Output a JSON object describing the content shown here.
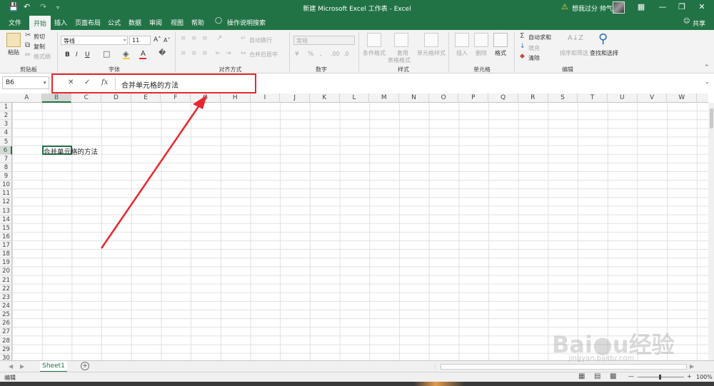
{
  "titlebar": {
    "title": "新建 Microsoft Excel 工作表 - Excel",
    "user": "想我过分 帅气",
    "save_icon": "save-icon",
    "undo_icon": "undo-icon",
    "redo_icon": "redo-icon",
    "warning_icon": "warning-icon"
  },
  "tabs": {
    "items": [
      "文件",
      "开始",
      "插入",
      "页面布局",
      "公式",
      "数据",
      "审阅",
      "视图",
      "帮助"
    ],
    "active": "开始",
    "tellme": "操作说明搜索",
    "share": "共享"
  },
  "ribbon": {
    "clipboard": {
      "label": "剪贴板",
      "paste": "粘贴",
      "cut": "剪切",
      "copy": "复制",
      "format_painter": "格式刷"
    },
    "font": {
      "label": "字体",
      "font_name": "等线",
      "font_size": "11",
      "bold": "B",
      "italic": "I",
      "underline": "U"
    },
    "alignment": {
      "label": "对齐方式",
      "wrap": "自动换行",
      "merge": "合并后居中"
    },
    "number": {
      "label": "数字",
      "format": "常规"
    },
    "styles": {
      "label": "样式",
      "conditional": "条件格式",
      "table_1": "套用",
      "table_2": "表格格式",
      "cell_styles": "单元格样式"
    },
    "cells": {
      "label": "单元格",
      "insert": "插入",
      "delete": "删除",
      "format": "格式"
    },
    "editing": {
      "label": "编辑",
      "autosum": "自动求和",
      "fill": "填充",
      "clear": "清除",
      "sort": "排序和筛选",
      "find": "查找和选择"
    }
  },
  "formula_bar": {
    "name_box": "B6",
    "cancel": "✕",
    "enter": "✓",
    "fx": "fx",
    "value": "合并单元格的方法"
  },
  "grid": {
    "columns": [
      "A",
      "B",
      "C",
      "D",
      "E",
      "F",
      "G",
      "H",
      "I",
      "J",
      "K",
      "L",
      "M",
      "N",
      "O",
      "P",
      "Q",
      "R",
      "S",
      "T",
      "U",
      "V",
      "W"
    ],
    "selected_column": "B",
    "rows": [
      "1",
      "2",
      "3",
      "4",
      "5",
      "6",
      "7",
      "8",
      "9",
      "10",
      "11",
      "12",
      "13",
      "14",
      "15",
      "16",
      "17",
      "18",
      "19",
      "20",
      "21",
      "22",
      "23",
      "24",
      "25",
      "26",
      "27",
      "28",
      "29",
      "30"
    ],
    "selected_row": "6",
    "cell_b6": "合并单元格的方法"
  },
  "sheets": {
    "tab": "Sheet1",
    "add": "+"
  },
  "status": {
    "mode": "编辑",
    "zoom": "100%"
  },
  "watermark": {
    "text": "Bai经验",
    "sub": "jingyan.baidu.com"
  },
  "colors": {
    "accent": "#217346",
    "highlight": "#e8272e"
  }
}
